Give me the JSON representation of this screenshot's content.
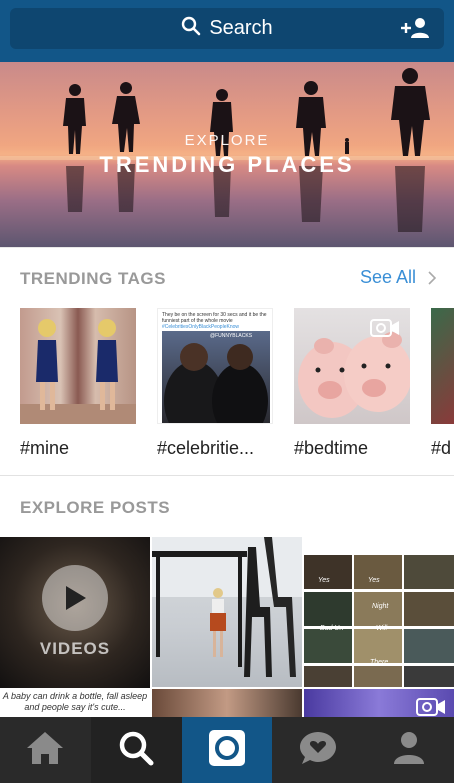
{
  "header": {
    "search_label": "Search",
    "icons": [
      "search-icon",
      "add-user-icon"
    ]
  },
  "hero": {
    "subtitle": "EXPLORE",
    "title": "TRENDING PLACES"
  },
  "trending_tags": {
    "heading": "TRENDING TAGS",
    "see_all": "See All",
    "tags": [
      {
        "label": "#mine"
      },
      {
        "label": "#celebritie..."
      },
      {
        "label": "#bedtime",
        "video": true
      },
      {
        "label": "#d"
      }
    ],
    "thumb2_caption": "They be on the screen for 30 secs and it be the funniest part of the whole movie",
    "thumb2_hashtag": "#CelebritiesOnlyBlackPeopleKnow",
    "thumb2_brand": "@FUNNYBLACKS"
  },
  "explore_posts": {
    "heading": "EXPLORE POSTS",
    "videos_label": "VIDEOS",
    "caption": "A baby can drink a bottle, fall asleep and people say it's cute...",
    "collage_words": [
      "Yes",
      "Yes",
      "Night",
      "Bad Un",
      "Will",
      "There"
    ]
  },
  "tabbar": {
    "tabs": [
      "home-icon",
      "search-icon",
      "camera-icon",
      "activity-icon",
      "profile-icon"
    ]
  },
  "colors": {
    "brand": "#125688",
    "brand_dark": "#0e4670",
    "link": "#3a8fd6",
    "tabbar": "#2a2a2a"
  }
}
